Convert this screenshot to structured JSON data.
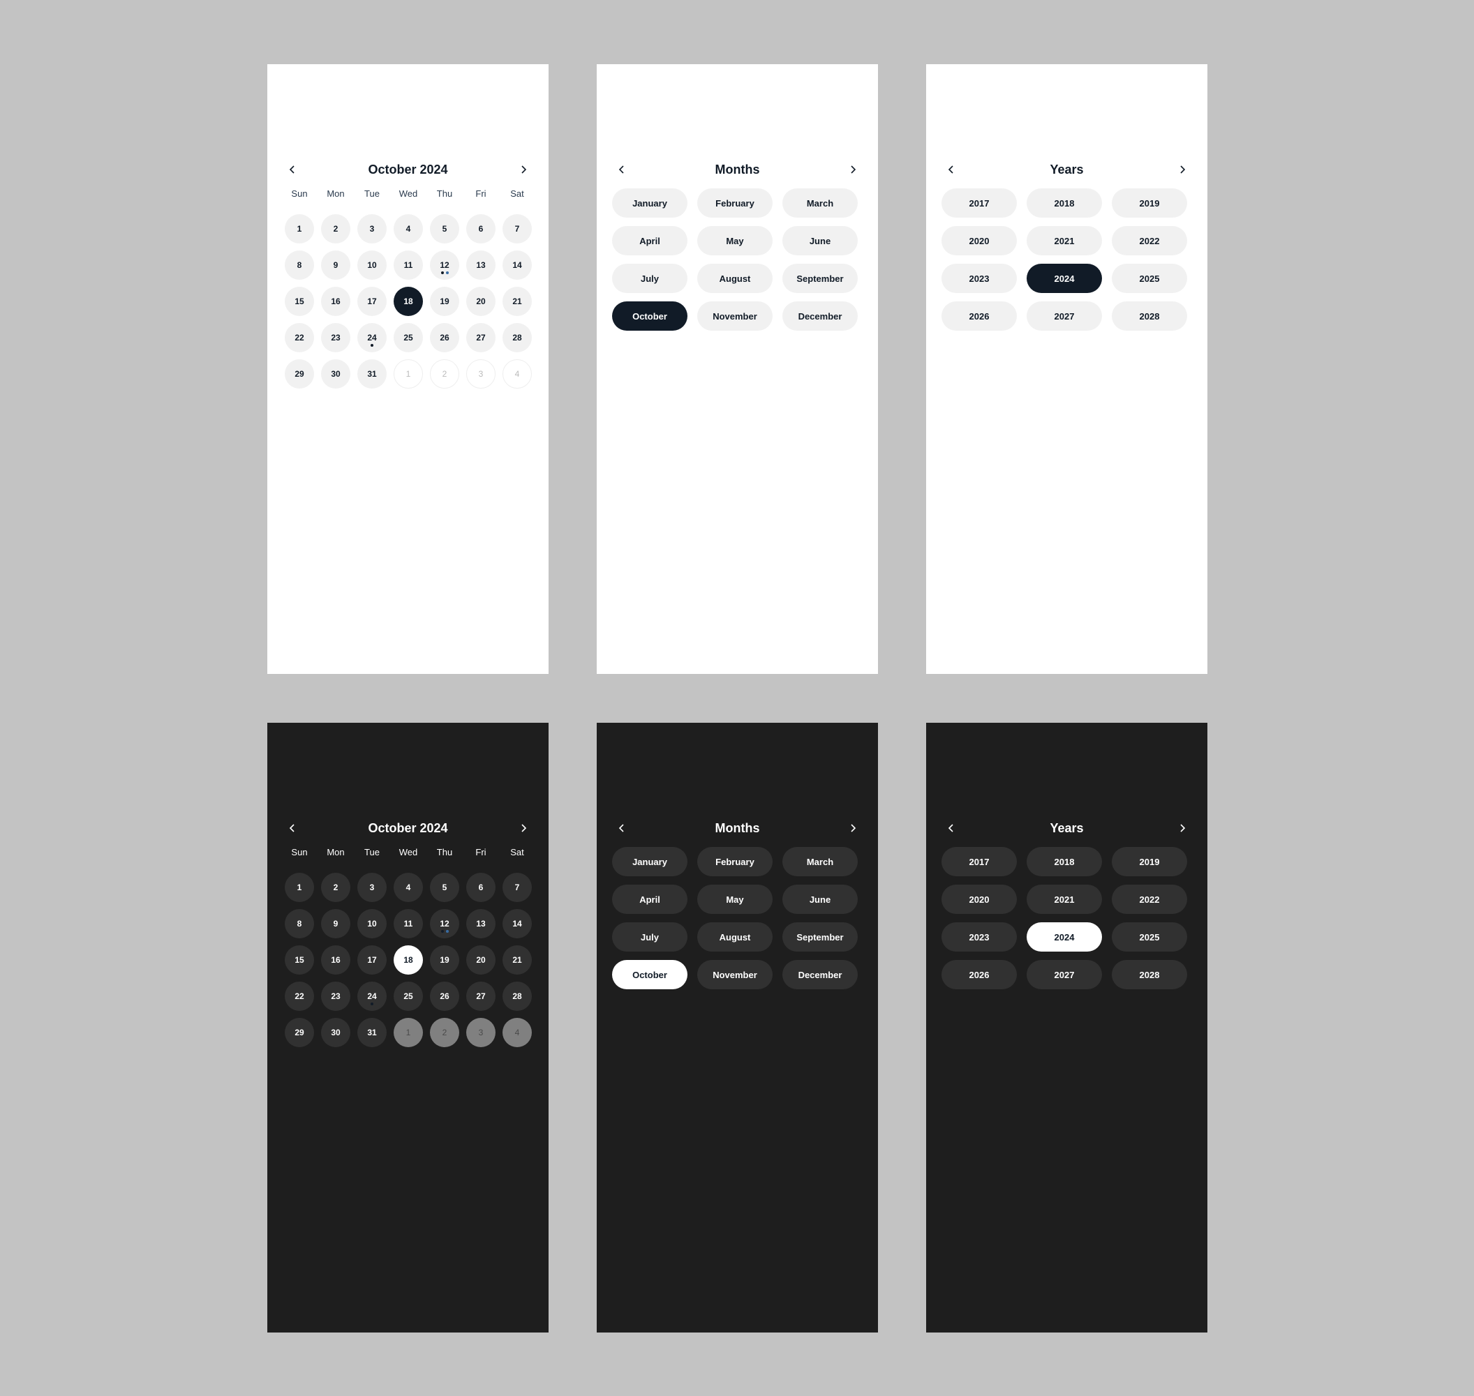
{
  "colors": {
    "canvas": "#c3c3c3",
    "light_panel": "#ffffff",
    "dark_panel": "#1e1e1e",
    "accent": "#111b27",
    "dot_dark": "#111b27",
    "dot_blue": "#3a6ea5"
  },
  "day_view": {
    "title": "October 2024",
    "weekdays": [
      "Sun",
      "Mon",
      "Tue",
      "Wed",
      "Thu",
      "Fri",
      "Sat"
    ],
    "days": [
      {
        "n": "1"
      },
      {
        "n": "2"
      },
      {
        "n": "3"
      },
      {
        "n": "4"
      },
      {
        "n": "5"
      },
      {
        "n": "6"
      },
      {
        "n": "7"
      },
      {
        "n": "8"
      },
      {
        "n": "9"
      },
      {
        "n": "10"
      },
      {
        "n": "11"
      },
      {
        "n": "12",
        "dots": [
          "dark",
          "blue"
        ]
      },
      {
        "n": "13"
      },
      {
        "n": "14"
      },
      {
        "n": "15"
      },
      {
        "n": "16"
      },
      {
        "n": "17"
      },
      {
        "n": "18",
        "selected": true
      },
      {
        "n": "19"
      },
      {
        "n": "20"
      },
      {
        "n": "21"
      },
      {
        "n": "22"
      },
      {
        "n": "23"
      },
      {
        "n": "24",
        "dots": [
          "dark"
        ]
      },
      {
        "n": "25"
      },
      {
        "n": "26"
      },
      {
        "n": "27"
      },
      {
        "n": "28"
      },
      {
        "n": "29"
      },
      {
        "n": "30"
      },
      {
        "n": "31"
      },
      {
        "n": "1",
        "outside": true
      },
      {
        "n": "2",
        "outside": true
      },
      {
        "n": "3",
        "outside": true
      },
      {
        "n": "4",
        "outside": true
      }
    ]
  },
  "month_view": {
    "title": "Months",
    "items": [
      "January",
      "February",
      "March",
      "April",
      "May",
      "June",
      "July",
      "August",
      "September",
      "October",
      "November",
      "December"
    ],
    "selected": "October"
  },
  "year_view": {
    "title": "Years",
    "items": [
      "2017",
      "2018",
      "2019",
      "2020",
      "2021",
      "2022",
      "2023",
      "2024",
      "2025",
      "2026",
      "2027",
      "2028"
    ],
    "selected": "2024"
  }
}
